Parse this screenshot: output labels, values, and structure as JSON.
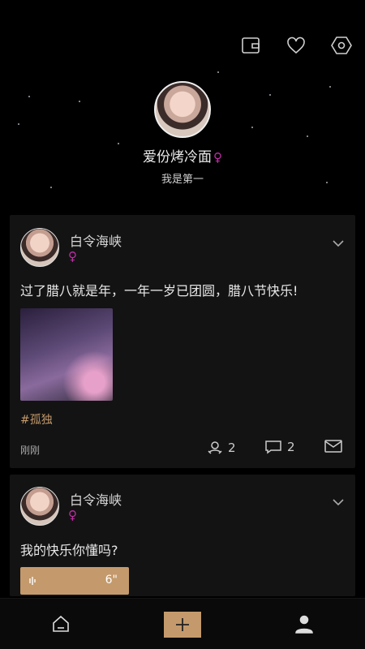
{
  "profile": {
    "name": "爱份烤冷面",
    "gender_symbol": "♀",
    "signature": "我是第一"
  },
  "top_icons": [
    "wallet-icon",
    "heart-icon",
    "settings-hexagon-icon"
  ],
  "posts": [
    {
      "username": "白令海峡",
      "gender_symbol": "♀",
      "text": "过了腊八就是年，一年一岁已团圆，腊八节快乐!",
      "tag": "#孤独",
      "time": "刚刚",
      "likes": "2",
      "comments": "2"
    },
    {
      "username": "白令海峡",
      "gender_symbol": "♀",
      "text": "我的快乐你懂吗?",
      "voice_length": "6\""
    }
  ],
  "bottom_nav": [
    "home-icon",
    "add-icon",
    "profile-icon"
  ],
  "colors": {
    "background": "#000000",
    "card": "#131313",
    "accent": "#c49a6c",
    "female": "#c02ea6"
  }
}
